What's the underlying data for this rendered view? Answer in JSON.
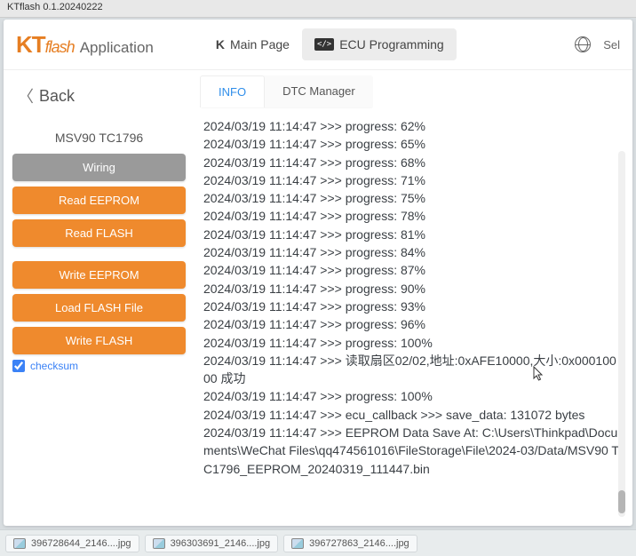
{
  "window": {
    "title": "KTflash 0.1.20240222"
  },
  "header": {
    "logo_prefix": "KT",
    "logo_suffix": "flash",
    "logo_app": "Application",
    "nav_main": "Main Page",
    "nav_ecu": "ECU Programming",
    "lang_sel": "Sel"
  },
  "sidebar": {
    "back": "Back",
    "ecu": "MSV90 TC1796",
    "wiring": "Wiring",
    "read_eeprom": "Read EEPROM",
    "read_flash": "Read FLASH",
    "write_eeprom": "Write EEPROM",
    "load_flash": "Load FLASH File",
    "write_flash": "Write FLASH",
    "checksum": "checksum"
  },
  "tabs": {
    "info": "INFO",
    "dtc": "DTC Manager"
  },
  "log": [
    "2024/03/19 11:14:47 >>> progress: 62%",
    "2024/03/19 11:14:47 >>> progress: 65%",
    "2024/03/19 11:14:47 >>> progress: 68%",
    "2024/03/19 11:14:47 >>> progress: 71%",
    "2024/03/19 11:14:47 >>> progress: 75%",
    "2024/03/19 11:14:47 >>> progress: 78%",
    "2024/03/19 11:14:47 >>> progress: 81%",
    "2024/03/19 11:14:47 >>> progress: 84%",
    "2024/03/19 11:14:47 >>> progress: 87%",
    "2024/03/19 11:14:47 >>> progress: 90%",
    "2024/03/19 11:14:47 >>> progress: 93%",
    "2024/03/19 11:14:47 >>> progress: 96%",
    "2024/03/19 11:14:47 >>> progress: 100%",
    "2024/03/19 11:14:47 >>> 读取扇区02/02,地址:0xAFE10000,大小:0x00010000 成功",
    "2024/03/19 11:14:47 >>> progress: 100%",
    "2024/03/19 11:14:47 >>> ecu_callback >>> save_data:  131072  bytes",
    "2024/03/19 11:14:47 >>> EEPROM Data Save At: C:\\Users\\Thinkpad\\Documents\\WeChat Files\\qq474561016\\FileStorage\\File\\2024-03/Data/MSV90 TC1796_EEPROM_20240319_111447.bin"
  ],
  "taskbar": {
    "items": [
      "396728644_2146....jpg",
      "396303691_2146....jpg",
      "396727863_2146....jpg"
    ]
  }
}
